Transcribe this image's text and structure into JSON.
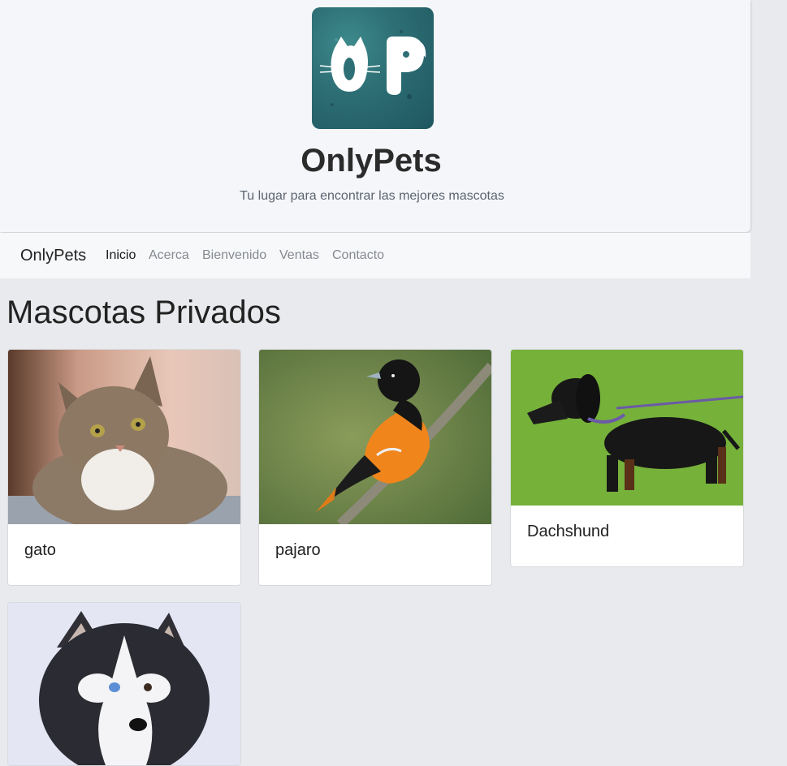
{
  "hero": {
    "title": "OnlyPets",
    "subtitle": "Tu lugar para encontrar las mejores mascotas",
    "logo_letters": "OP"
  },
  "navbar": {
    "brand": "OnlyPets",
    "links": [
      "Inicio",
      "Acerca",
      "Bienvenido",
      "Ventas",
      "Contacto"
    ]
  },
  "section": {
    "title": "Mascotas Privados"
  },
  "cards": [
    {
      "name": "gato"
    },
    {
      "name": "pajaro"
    },
    {
      "name": "Dachshund"
    },
    {
      "name": ""
    }
  ]
}
